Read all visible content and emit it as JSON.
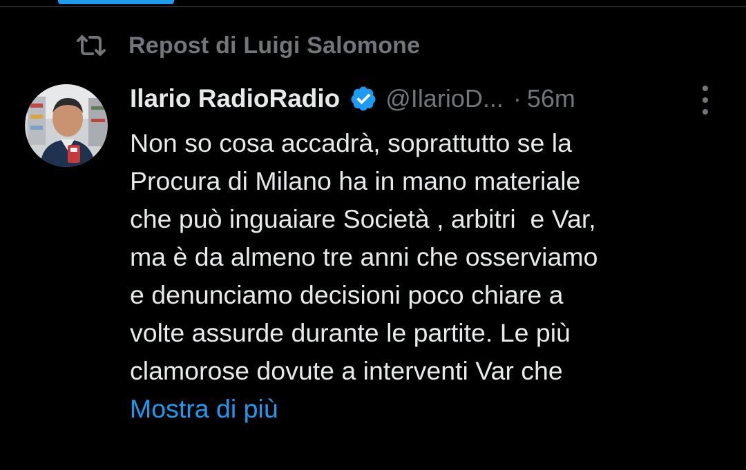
{
  "colors": {
    "background": "#000000",
    "text_primary": "#e7e9ea",
    "text_secondary": "#71767b",
    "accent": "#1d9bf0"
  },
  "repost": {
    "icon": "repost-icon",
    "label": "Repost di Luigi Salomone"
  },
  "tweet": {
    "author": {
      "display_name": "Ilario RadioRadio",
      "verified_icon": "verified-badge-icon",
      "handle": "@IlarioD...",
      "separator": "·",
      "time": "56m"
    },
    "more_icon": "more-vertical-icon",
    "lines": [
      "Non so cosa accadrà, soprattutto se la",
      "Procura di Milano ha in mano materiale",
      "che può inguaiare Società , arbitri  e Var,",
      "ma è da almeno tre anni che osserviamo",
      "e denunciamo decisioni poco chiare a",
      "volte assurde durante le partite. Le più",
      "clamorose dovute a interventi Var che"
    ],
    "show_more": "Mostra di più"
  }
}
